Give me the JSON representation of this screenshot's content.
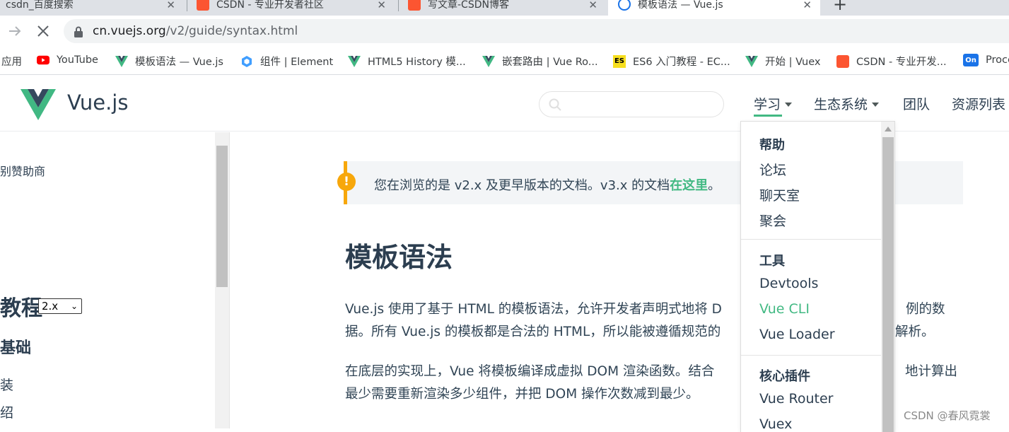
{
  "browser": {
    "tabs": [
      {
        "title": "csdn_百度搜索",
        "favicon": "baidu-icon",
        "active": false
      },
      {
        "title": "CSDN - 专业开发者社区",
        "favicon": "csdn-icon",
        "active": false
      },
      {
        "title": "写文章-CSDN博客",
        "favicon": "csdn-icon",
        "active": false
      },
      {
        "title": "模板语法 — Vue.js",
        "favicon": "loading-icon",
        "active": true
      }
    ],
    "close_glyph": "✕",
    "new_tab_glyph": "+",
    "url_host": "cn.vuejs.org",
    "url_path": "/v2/guide/syntax.html",
    "bookmarks": [
      {
        "label": "应用",
        "icon": "apps-icon"
      },
      {
        "label": "YouTube",
        "icon": "youtube-icon"
      },
      {
        "label": "模板语法 — Vue.js",
        "icon": "vue-icon"
      },
      {
        "label": "组件 | Element",
        "icon": "element-icon"
      },
      {
        "label": "HTML5 History 模...",
        "icon": "vue-icon"
      },
      {
        "label": "嵌套路由 | Vue Ro...",
        "icon": "vue-icon"
      },
      {
        "label": "ES6 入门教程 - EC...",
        "icon": "es6-icon",
        "icon_text": "ES"
      },
      {
        "label": "开始 | Vuex",
        "icon": "vue-icon"
      },
      {
        "label": "CSDN - 专业开发...",
        "icon": "csdn-icon"
      },
      {
        "label": "Proce",
        "icon": "on-icon",
        "icon_text": "On"
      }
    ]
  },
  "site": {
    "name": "Vue.js",
    "nav": [
      "学习",
      "生态系统",
      "团队",
      "资源列表"
    ]
  },
  "sidebar": {
    "sponsor_text": "别赞助商",
    "tutorial_heading": "教程",
    "version_selected": "2.x",
    "section_heading": "基础",
    "items": [
      "装",
      "绍"
    ]
  },
  "notice": {
    "text": "您在浏览的是 v2.x 及更早版本的文档。v3.x 的文档",
    "link": "在这里",
    "end": "。"
  },
  "main": {
    "title": "模板语法",
    "para1_line1": "Vue.js 使用了基于 HTML 的模板语法，允许开发者声明式地将 D",
    "para1_line1_tail": "例的数",
    "para1_line2": "据。所有 Vue.js 的模板都是合法的 HTML，所以能被遵循规范的",
    "para1_line2_tail": "解析。",
    "para2_line1": "在底层的实现上，Vue 将模板编译成虚拟 DOM 渲染函数。结合",
    "para2_line1_tail": "地计算出",
    "para2_line2": "最少需要重新渲染多少组件，并把 DOM 操作次数减到最少。"
  },
  "dropdown": {
    "groups": [
      {
        "heading": "帮助",
        "items": [
          "论坛",
          "聊天室",
          "聚会"
        ]
      },
      {
        "heading": "工具",
        "items": [
          "Devtools",
          "Vue CLI",
          "Vue Loader"
        ]
      },
      {
        "heading": "核心插件",
        "items": [
          "Vue Router",
          "Vuex"
        ]
      }
    ],
    "active_item": "Vue CLI"
  },
  "watermark": "CSDN @春风霓裳",
  "colors": {
    "accent": "#42b983",
    "warning": "#f7a70b",
    "text": "#2c3e50"
  }
}
